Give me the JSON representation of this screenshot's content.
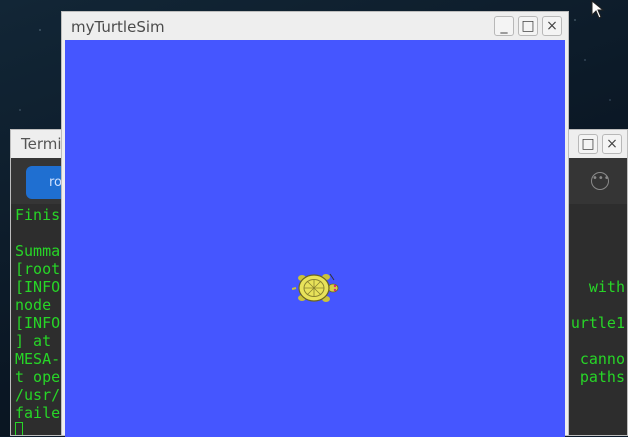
{
  "terminal": {
    "title": "Termi",
    "tab_label": "ro",
    "more_icon": "ellipsis-circle-icon",
    "lines_left": [
      "Finis",
      "",
      "Summa",
      "[root",
      "[INFO",
      "node ",
      "[INFO",
      "] at ",
      "MESA-",
      "t ope",
      "/usr/",
      "failed"
    ],
    "lines_right": [
      {
        "row": 4,
        "text": "with"
      },
      {
        "row": 6,
        "text": "urtle1"
      },
      {
        "row": 8,
        "text": "canno"
      },
      {
        "row": 9,
        "text": "paths"
      }
    ]
  },
  "turtlesim": {
    "title": "myTurtleSim",
    "canvas_color": "#4556ff",
    "turtle_icon": "turtle-icon"
  },
  "window_controls": {
    "minimize": "_",
    "maximize": "□",
    "close": "×"
  }
}
